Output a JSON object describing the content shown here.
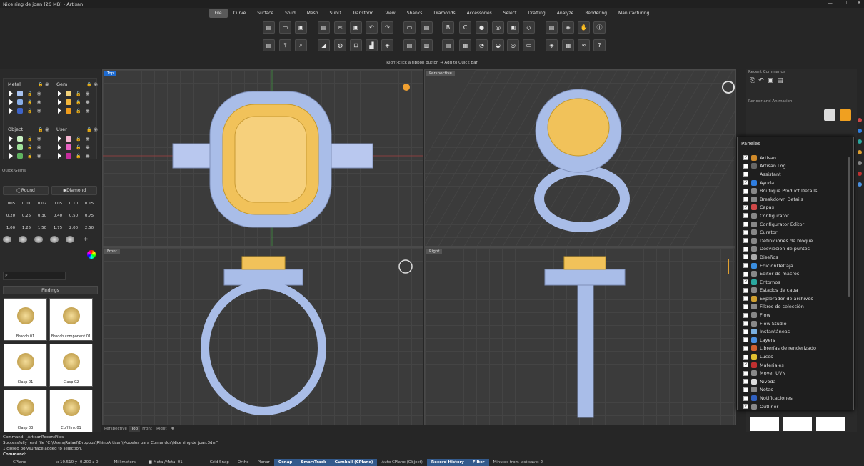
{
  "title": "Nice ring de joan (26 MB) - Artisan",
  "menu": [
    "File",
    "Curve",
    "Surface",
    "Solid",
    "Mesh",
    "SubD",
    "Transform",
    "View",
    "Shanks",
    "Diamonds",
    "Accessories",
    "Select",
    "Drafting",
    "Analyze",
    "Rendering",
    "Manufacturing"
  ],
  "ribbon_hint": "Right-click a ribbon button → Add to Quick Bar",
  "layers": {
    "metal": "Metal",
    "gem": "Gem",
    "object": "Object",
    "user": "User",
    "metal_colors": [
      "#a9c4f2",
      "#88aee8",
      "#3e64c9"
    ],
    "gem_colors": [
      "#f3d27a",
      "#f2b63c",
      "#ef9c1c"
    ],
    "object_colors": [
      "#c9f2c4",
      "#9fe39a",
      "#5fb360"
    ],
    "user_colors": [
      "#f5b6d0",
      "#ea63c4",
      "#c62c9c"
    ]
  },
  "quick_gems": {
    "title": "Quick Gems",
    "round": "Round",
    "diamond": "Diamond",
    "sizes": [
      [
        ".005",
        "0.01",
        "0.02",
        "0.05",
        "0.10",
        "0.15"
      ],
      [
        "0.20",
        "0.25",
        "0.30",
        "0.40",
        "0.50",
        "0.75"
      ],
      [
        "1.00",
        "1.25",
        "1.50",
        "1.75",
        "2.00",
        "2.50"
      ]
    ]
  },
  "findings": {
    "label": "Findings",
    "items": [
      "Brooch 01",
      "Brooch component 01",
      "Clasp 01",
      "Clasp 02",
      "Clasp 03",
      "Cuff link 01"
    ]
  },
  "viewports": {
    "top": "Top",
    "perspective": "Perspective",
    "front": "Front",
    "right": "Right"
  },
  "viewport_tabs": [
    "Perspective",
    "Top",
    "Front",
    "Right"
  ],
  "command_lines": [
    "Command: _ArtisanRecentFiles",
    "Successfully read file \"C:\\Users\\Rafael\\Dropbox\\RhinoArtisan\\Modelos para Comandos\\Nice ring de joan.3dm\"",
    "1 closed polysurface added to selection."
  ],
  "command_prompt": "Command:",
  "status": {
    "cplane": "CPlane",
    "coords": "x 10.510  y -0.200  z 0",
    "units": "Millimeters",
    "layer": "Metal/Metal 01",
    "grid_snap": "Grid Snap",
    "ortho": "Ortho",
    "planar": "Planar",
    "osnap": "Osnap",
    "smarttrack": "SmartTrack",
    "gumball": "Gumball (CPlane)",
    "auto_cplane": "Auto CPlane (Object)",
    "record_history": "Record History",
    "filter": "Filter",
    "minutes": "Minutes from last save: 2"
  },
  "right_panel": {
    "recent_commands": "Recent Commands",
    "render_animation": "Render and Animation"
  },
  "paneles": {
    "title": "Paneles",
    "items": [
      {
        "label": "Artisan",
        "checked": true,
        "color": "#d08a2a"
      },
      {
        "label": "Artisan Log",
        "checked": false,
        "color": "#666"
      },
      {
        "label": "Assistant",
        "checked": false,
        "color": "#1e1e1e"
      },
      {
        "label": "Ayuda",
        "checked": true,
        "color": "#2f7ee0"
      },
      {
        "label": "Boutique Product Details",
        "checked": false,
        "color": "#888"
      },
      {
        "label": "Breakdown Details",
        "checked": false,
        "color": "#888"
      },
      {
        "label": "Capas",
        "checked": true,
        "color": "#d04848"
      },
      {
        "label": "Configurator",
        "checked": false,
        "color": "#888"
      },
      {
        "label": "Configurator Editor",
        "checked": false,
        "color": "#888"
      },
      {
        "label": "Curator",
        "checked": false,
        "color": "#888"
      },
      {
        "label": "Definiciones de bloque",
        "checked": false,
        "color": "#888"
      },
      {
        "label": "Desviación de puntos",
        "checked": false,
        "color": "#888"
      },
      {
        "label": "Diseños",
        "checked": false,
        "color": "#aaa"
      },
      {
        "label": "EdiciónDeCaja",
        "checked": false,
        "color": "#3a8ee0"
      },
      {
        "label": "Editor de macros",
        "checked": false,
        "color": "#888"
      },
      {
        "label": "Entornos",
        "checked": true,
        "color": "#2aa8a0"
      },
      {
        "label": "Estados de capa",
        "checked": false,
        "color": "#888"
      },
      {
        "label": "Explorador de archivos",
        "checked": false,
        "color": "#d0a030"
      },
      {
        "label": "Filtros de selección",
        "checked": false,
        "color": "#888"
      },
      {
        "label": "Flow",
        "checked": false,
        "color": "#888"
      },
      {
        "label": "Flow Studio",
        "checked": false,
        "color": "#888"
      },
      {
        "label": "Instantáneas",
        "checked": false,
        "color": "#7ab0e0"
      },
      {
        "label": "Layers",
        "checked": false,
        "color": "#4a90e0"
      },
      {
        "label": "Librerías de renderizado",
        "checked": false,
        "color": "#d06030"
      },
      {
        "label": "Luces",
        "checked": false,
        "color": "#e0c030"
      },
      {
        "label": "Materiales",
        "checked": true,
        "color": "#c03030"
      },
      {
        "label": "Mover UVN",
        "checked": false,
        "color": "#888"
      },
      {
        "label": "Nivoda",
        "checked": false,
        "color": "#ddd"
      },
      {
        "label": "Notas",
        "checked": false,
        "color": "#888"
      },
      {
        "label": "Notificaciones",
        "checked": false,
        "color": "#3060c0"
      },
      {
        "label": "Outliner",
        "checked": true,
        "color": "#888"
      }
    ]
  }
}
